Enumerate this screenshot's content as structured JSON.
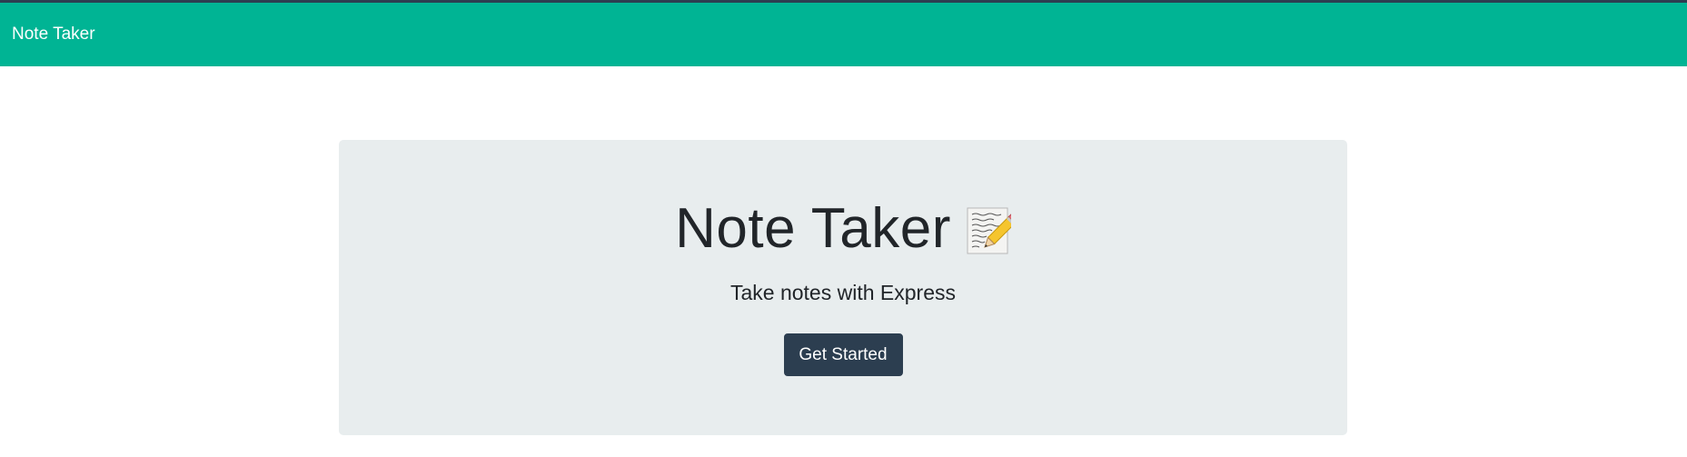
{
  "navbar": {
    "brand": "Note Taker"
  },
  "hero": {
    "title": "Note Taker",
    "title_icon": "memo-icon",
    "subtitle": "Take notes with Express",
    "cta_label": "Get Started"
  },
  "colors": {
    "navbar_bg": "#00b494",
    "top_border": "#2c3e50",
    "jumbotron_bg": "#e8edee",
    "button_bg": "#2c3e50",
    "text": "#212529"
  }
}
